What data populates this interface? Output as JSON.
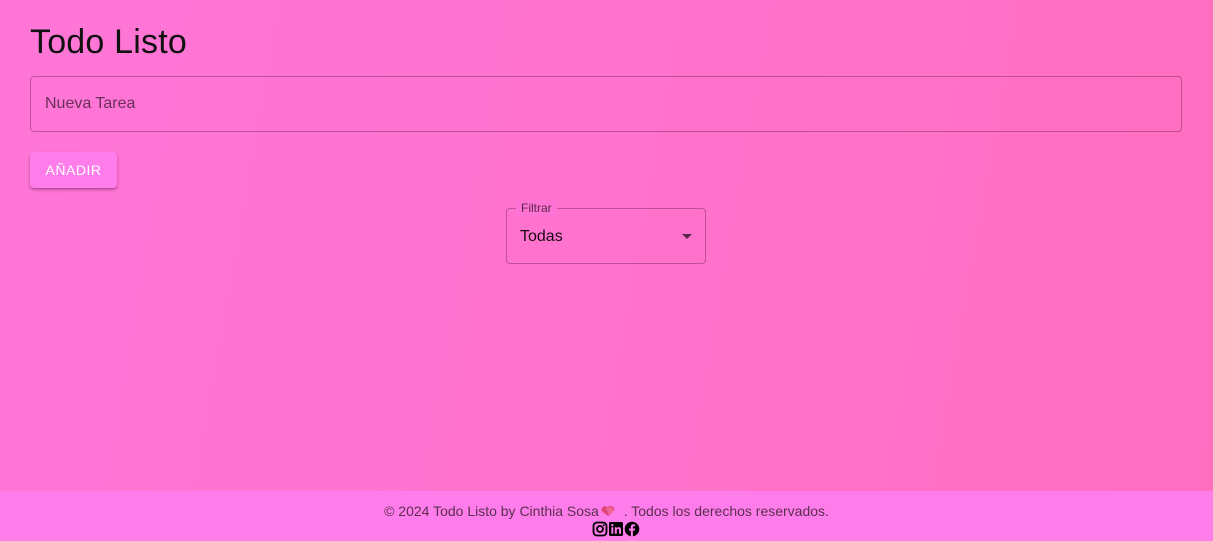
{
  "app": {
    "title": "Todo Listo"
  },
  "task_input": {
    "placeholder": "Nueva Tarea",
    "value": ""
  },
  "add_button": {
    "label": "AÑADIR"
  },
  "filter": {
    "label": "Filtrar",
    "selected": "Todas"
  },
  "footer": {
    "text_before": "© 2024 Todo Listo by Cinthia Sosa",
    "text_after": ". Todos los derechos reservados.",
    "heart_icon": "heart-icon",
    "social_icons": [
      "instagram-icon",
      "linkedin-icon",
      "facebook-icon"
    ]
  },
  "colors": {
    "background": "#ff72cc",
    "button": "#ff7ceb",
    "footer": "#ff7ceb"
  }
}
